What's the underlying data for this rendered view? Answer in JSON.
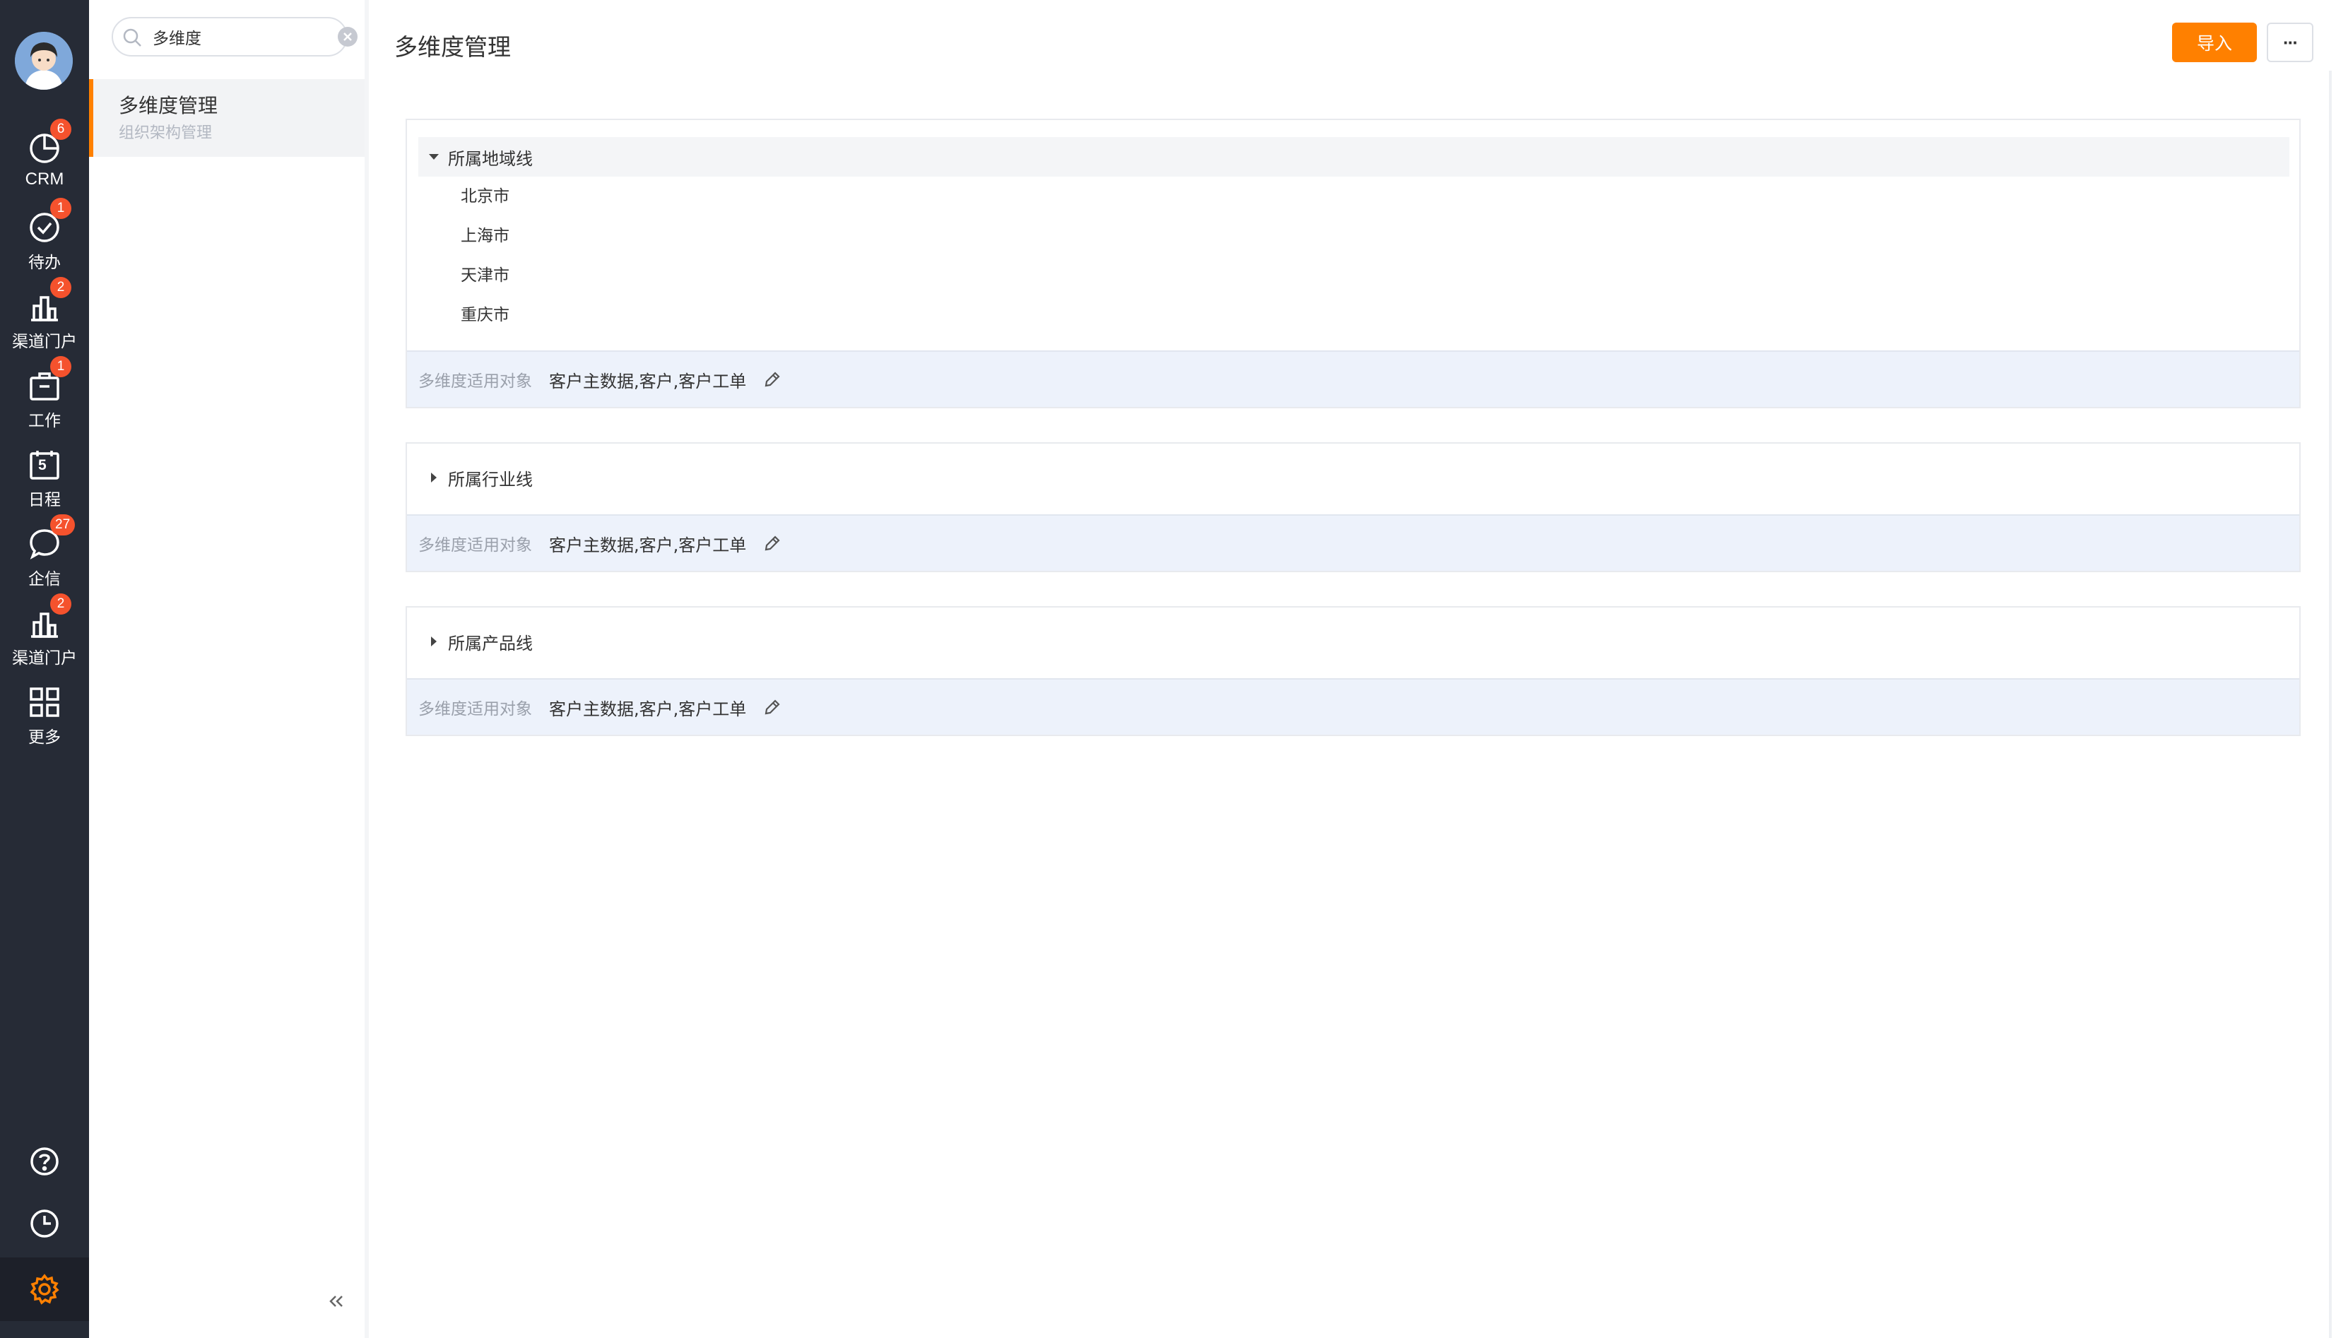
{
  "nav": {
    "items": [
      {
        "label": "CRM",
        "icon": "crm-icon",
        "badge": "6"
      },
      {
        "label": "待办",
        "icon": "check-circle-icon",
        "badge": "1"
      },
      {
        "label": "渠道门户",
        "icon": "building-icon",
        "badge": "2"
      },
      {
        "label": "工作",
        "icon": "briefcase-icon",
        "badge": "1"
      },
      {
        "label": "日程",
        "icon": "calendar-icon",
        "badge": "",
        "day": "5"
      },
      {
        "label": "企信",
        "icon": "chat-bubble-icon",
        "badge": "27"
      },
      {
        "label": "渠道门户",
        "icon": "building-icon",
        "badge": "2"
      },
      {
        "label": "更多",
        "icon": "grid-icon",
        "badge": ""
      }
    ],
    "bottom": [
      "help-icon",
      "clock-icon",
      "gear-icon"
    ],
    "accent": "#ff8000"
  },
  "search": {
    "value": "多维度"
  },
  "menu": {
    "title": "多维度管理",
    "subtitle": "组织架构管理"
  },
  "main": {
    "title": "多维度管理",
    "import_label": "导入",
    "more_label": "···"
  },
  "cards": [
    {
      "label": "所属地域线",
      "expanded": true,
      "children": [
        "北京市",
        "上海市",
        "天津市",
        "重庆市"
      ],
      "footer_label": "多维度适用对象",
      "footer_value": "客户主数据,客户,客户工单"
    },
    {
      "label": "所属行业线",
      "expanded": false,
      "children": [],
      "footer_label": "多维度适用对象",
      "footer_value": "客户主数据,客户,客户工单"
    },
    {
      "label": "所属产品线",
      "expanded": false,
      "children": [],
      "footer_label": "多维度适用对象",
      "footer_value": "客户主数据,客户,客户工单"
    }
  ]
}
